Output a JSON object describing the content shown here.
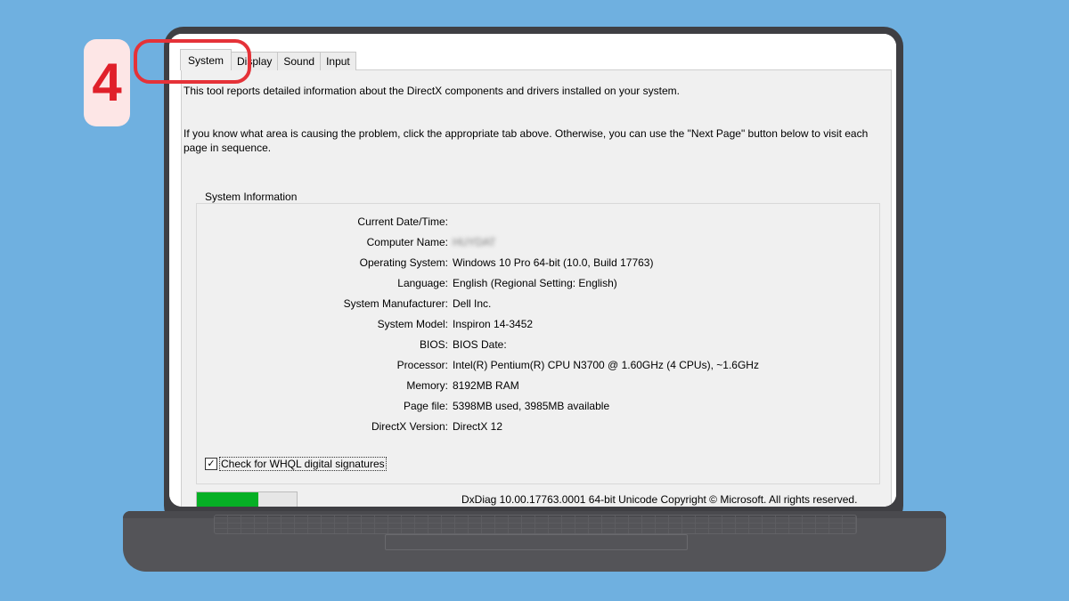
{
  "step_badge": "4",
  "tabs": [
    {
      "label": "System",
      "active": true
    },
    {
      "label": "Display"
    },
    {
      "label": "Sound"
    },
    {
      "label": "Input"
    }
  ],
  "intro": {
    "line1": "This tool reports detailed information about the DirectX components and drivers installed on your system.",
    "line2": "If you know what area is causing the problem, click the appropriate tab above.  Otherwise, you can use the \"Next Page\" button below to visit each page in sequence."
  },
  "system_info": {
    "title": "System Information",
    "rows": [
      {
        "label": "Current Date/Time:",
        "value": ""
      },
      {
        "label": "Computer Name:",
        "value": "HUYDAT"
      },
      {
        "label": "Operating System:",
        "value": "Windows 10 Pro 64-bit (10.0, Build 17763)"
      },
      {
        "label": "Language:",
        "value": "English (Regional Setting: English)"
      },
      {
        "label": "System Manufacturer:",
        "value": "Dell Inc."
      },
      {
        "label": "System Model:",
        "value": "Inspiron 14-3452"
      },
      {
        "label": "BIOS:",
        "value": "BIOS Date:"
      },
      {
        "label": "Processor:",
        "value": "Intel(R) Pentium(R) CPU  N3700  @ 1.60GHz (4 CPUs), ~1.6GHz"
      },
      {
        "label": "Memory:",
        "value": "8192MB RAM"
      },
      {
        "label": "Page file:",
        "value": "5398MB used, 3985MB available"
      },
      {
        "label": "DirectX Version:",
        "value": "DirectX 12"
      }
    ]
  },
  "whql": {
    "label": "Check for WHQL digital signatures",
    "checked": true,
    "mark": "✓"
  },
  "progress": {
    "fraction": 0.62
  },
  "footer": {
    "copyright": "DxDiag 10.00.17763.0001 64-bit Unicode  Copyright © Microsoft. All rights reserved."
  },
  "colors": {
    "background": "#6fb0e0",
    "highlight": "#e53238",
    "progress": "#06b025",
    "badge_text": "#e0202a"
  }
}
